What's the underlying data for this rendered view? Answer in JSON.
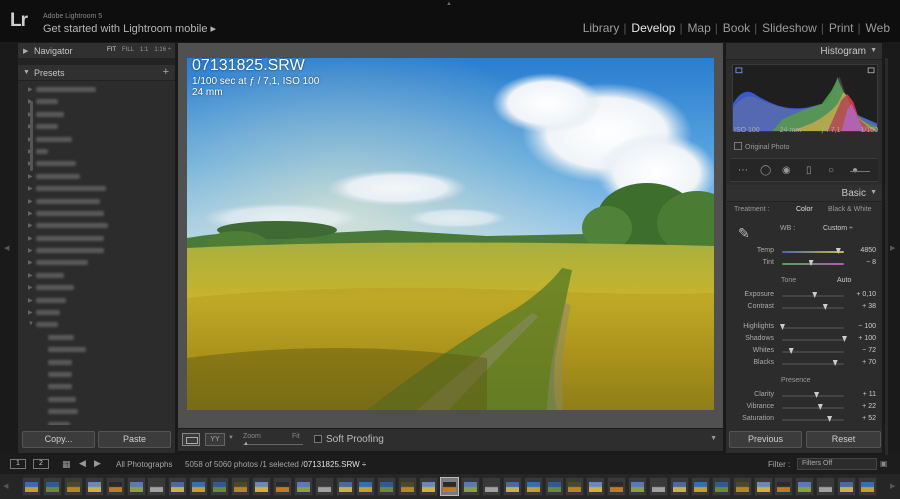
{
  "app": {
    "logo": "Lr",
    "name": "Adobe Lightroom 5",
    "mobile_link": "Get started with Lightroom mobile ▸"
  },
  "modules": [
    {
      "label": "Library",
      "active": false
    },
    {
      "label": "Develop",
      "active": true
    },
    {
      "label": "Map",
      "active": false
    },
    {
      "label": "Book",
      "active": false
    },
    {
      "label": "Slideshow",
      "active": false
    },
    {
      "label": "Print",
      "active": false
    },
    {
      "label": "Web",
      "active": false
    }
  ],
  "left_panel": {
    "navigator": {
      "title": "Navigator",
      "modes": [
        "FIT",
        "FILL",
        "1:1",
        "1:16 ÷"
      ]
    },
    "presets": {
      "title": "Presets"
    },
    "copy_label": "Copy...",
    "paste_label": "Paste"
  },
  "photo_info": {
    "filename": "07131825.SRW",
    "exposure": "1/100 sec at ƒ / 7,1, ISO 100",
    "focal": "24 mm"
  },
  "toolbar": {
    "compare_icon": "YY",
    "zoom_label": "Zoom",
    "fit_label": "Fit",
    "soft_proofing_label": "Soft Proofing"
  },
  "right_panel": {
    "histogram": {
      "title": "Histogram",
      "iso": "ISO 100",
      "focal": "24 mm",
      "aperture": "ƒ / 7,1",
      "shutter": "1/100",
      "original_photo": "Original Photo"
    },
    "basic": {
      "title": "Basic",
      "treatment_label": "Treatment :",
      "treatment_color": "Color",
      "treatment_bw": "Black & White",
      "wb_label": "WB :",
      "wb_value": "Custom ÷",
      "tone_label": "Tone",
      "auto_label": "Auto",
      "presence_label": "Presence",
      "sliders": [
        {
          "key": "temp",
          "label": "Temp",
          "value": "4850",
          "position": 0.9
        },
        {
          "key": "tint",
          "label": "Tint",
          "value": "− 8",
          "position": 0.46
        },
        {
          "key": "exposure",
          "label": "Exposure",
          "value": "+ 0,10",
          "position": 0.52
        },
        {
          "key": "contrast",
          "label": "Contrast",
          "value": "+ 38",
          "position": 0.69
        },
        {
          "key": "highlights",
          "label": "Highlights",
          "value": "− 100",
          "position": 0.0
        },
        {
          "key": "shadows",
          "label": "Shadows",
          "value": "+ 100",
          "position": 1.0
        },
        {
          "key": "whites",
          "label": "Whites",
          "value": "− 72",
          "position": 0.14
        },
        {
          "key": "blacks",
          "label": "Blacks",
          "value": "+ 70",
          "position": 0.85
        },
        {
          "key": "clarity",
          "label": "Clarity",
          "value": "+ 11",
          "position": 0.55
        },
        {
          "key": "vibrance",
          "label": "Vibrance",
          "value": "+ 22",
          "position": 0.61
        },
        {
          "key": "saturation",
          "label": "Saturation",
          "value": "+ 52",
          "position": 0.76
        }
      ]
    },
    "previous_label": "Previous",
    "reset_label": "Reset"
  },
  "filmbar": {
    "monitor1": "1",
    "monitor2": "2",
    "collection": "All Photographs",
    "count": "5058 of 5060 photos /1 selected /",
    "selected_file": "07131825.SRW ÷",
    "filter_label": "Filter :",
    "filter_value": "Filters Off"
  },
  "filmstrip": {
    "thumb_count": 41,
    "selected_index": 20
  },
  "colors": {
    "accent": "#e8e8e8",
    "panel": "#2c2c2c",
    "background": "#1a1a1a"
  }
}
